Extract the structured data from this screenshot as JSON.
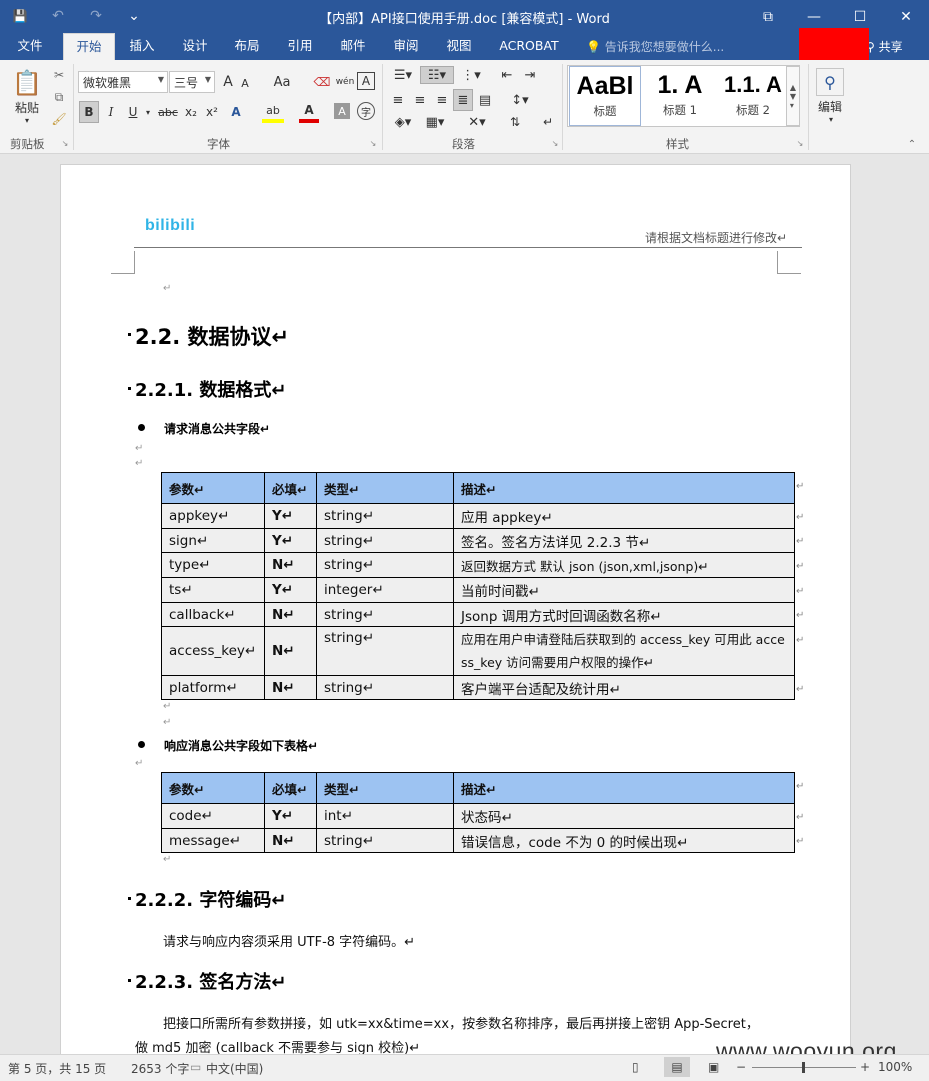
{
  "window": {
    "title": "【内部】API接口使用手册.doc [兼容模式] - Word",
    "controls": {
      "restore": "⧉",
      "minimize": "—",
      "maximize": "☐",
      "close": "✕"
    }
  },
  "qat": {
    "save": "💾",
    "undo": "↶",
    "redo": "↷",
    "customize": "⌄"
  },
  "tabs": [
    "文件",
    "开始",
    "插入",
    "设计",
    "布局",
    "引用",
    "邮件",
    "审阅",
    "视图",
    "ACROBAT"
  ],
  "active_tab": "开始",
  "tell_me": "告诉我您想要做什么...",
  "share": "共享",
  "ribbon": {
    "clipboard": {
      "paste": "粘贴",
      "label": "剪贴板"
    },
    "font": {
      "name": "微软雅黑",
      "size": "三号",
      "label": "字体",
      "bold": "B",
      "italic": "I",
      "underline": "U",
      "strike": "abc",
      "sub": "x₂",
      "sup": "x²",
      "grow": "A",
      "shrink": "A",
      "case": "Aa",
      "phonetic": "wén",
      "border": "A",
      "highlight": "ab",
      "color": "A",
      "shade": "A",
      "enclose": "字"
    },
    "paragraph": {
      "label": "段落"
    },
    "styles": {
      "label": "样式",
      "items": [
        {
          "preview": "AaBl",
          "name": "标题"
        },
        {
          "preview": "1.  A",
          "name": "标题 1"
        },
        {
          "preview": "1.1.  A",
          "name": "标题 2"
        }
      ]
    },
    "editing": {
      "label": "编辑"
    }
  },
  "document": {
    "header_logo": "bilibili",
    "header_text": "请根据文档标题进行修改↵",
    "para_mark": "↵",
    "h_2_2": "2.2. 数据协议↵",
    "h_2_2_1": "2.2.1. 数据格式↵",
    "bullet_request": "请求消息公共字段↵",
    "table_request": {
      "headers": [
        "参数↵",
        "必填↵",
        "类型↵",
        "描述↵"
      ],
      "rows": [
        [
          "appkey↵",
          "Y↵",
          "string↵",
          "应用 appkey↵"
        ],
        [
          "sign↵",
          "Y↵",
          "string↵",
          "签名。签名方法详见 2.2.3 节↵"
        ],
        [
          "type↵",
          "N↵",
          "string↵",
          "返回数据方式 默认 json (json,xml,jsonp)↵"
        ],
        [
          "ts↵",
          "Y↵",
          "integer↵",
          "当前时间戳↵"
        ],
        [
          "callback↵",
          "N↵",
          "string↵",
          "Jsonp 调用方式时回调函数名称↵"
        ],
        [
          "access_key↵",
          "N↵",
          "string↵",
          "应用在用户申请登陆后获取到的 access_key 可用此 access_key 访问需要用户权限的操作↵"
        ],
        [
          "platform↵",
          "N↵",
          "string↵",
          "客户端平台适配及统计用↵"
        ]
      ]
    },
    "bullet_response": "响应消息公共字段如下表格↵",
    "table_response": {
      "headers": [
        "参数↵",
        "必填↵",
        "类型↵",
        "描述↵"
      ],
      "rows": [
        [
          "code↵",
          "Y↵",
          "int↵",
          "状态码↵"
        ],
        [
          "message↵",
          "N↵",
          "string↵",
          "错误信息，code 不为 0 的时候出现↵"
        ]
      ]
    },
    "h_2_2_2": "2.2.2. 字符编码↵",
    "encoding_text": "请求与响应内容须采用 UTF-8 字符编码。↵",
    "h_2_2_3": "2.2.3. 签名方法↵",
    "sign_text_1": "把接口所需所有参数拼接，如 utk=xx&time=xx，按参数名称排序，最后再拼接上密钥 App-Secret，",
    "sign_text_2": "做 md5 加密 (callback 不需要参与 sign 校检)↵"
  },
  "watermark": "www.wooyun.org",
  "status": {
    "page": "第 5 页，共 15 页",
    "words": "2653 个字",
    "language": "中文(中国)",
    "zoom": "100%"
  }
}
